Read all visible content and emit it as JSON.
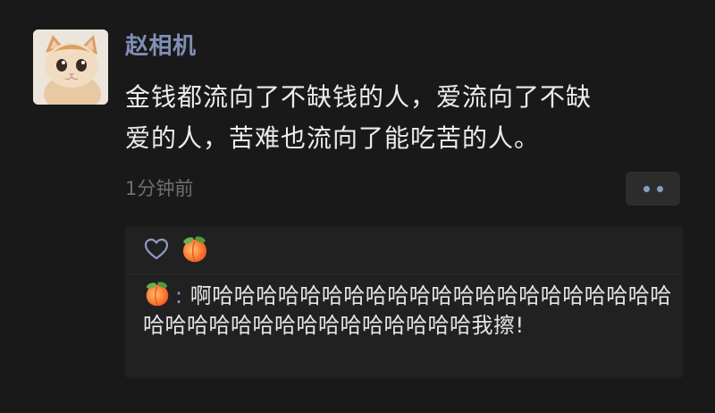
{
  "post": {
    "author": "赵相机",
    "content": "金钱都流向了不缺钱的人，爱流向了不缺\n爱的人，苦难也流向了能吃苦的人。",
    "time": "1分钟前"
  },
  "likes": {
    "icon": "heart-icon",
    "liker_icon": "peach-emoji"
  },
  "comment": {
    "commenter_icon": "peach-emoji",
    "separator": ":",
    "text": " 啊哈哈哈哈哈哈哈哈哈哈哈哈哈哈哈哈哈哈哈哈哈哈哈哈哈哈哈哈哈哈哈哈哈哈哈哈我擦!"
  },
  "colors": {
    "background": "#191919",
    "author_name": "#7f8fb4",
    "text": "#ececec",
    "time": "#6f6f6f",
    "panel": "#212121"
  }
}
